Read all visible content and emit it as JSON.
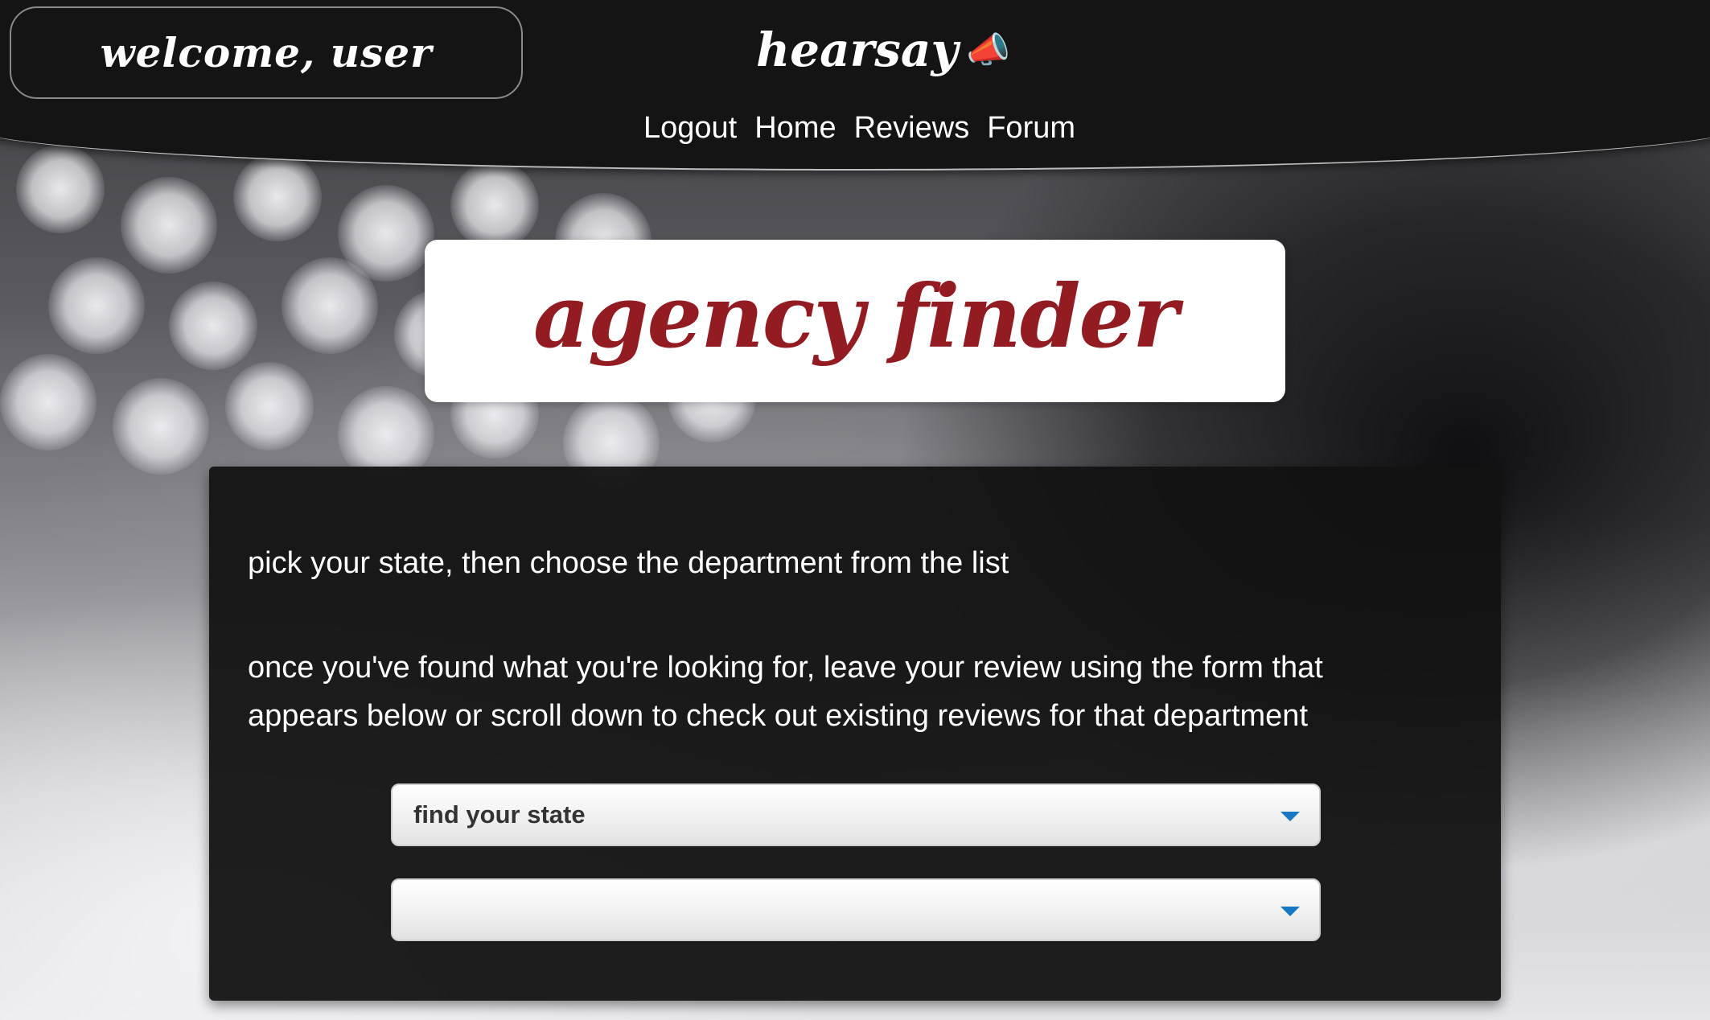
{
  "header": {
    "welcome_text": "welcome, user",
    "brand_name": "hearsay",
    "brand_icon": "megaphone-icon",
    "nav": [
      {
        "label": "Logout"
      },
      {
        "label": "Home"
      },
      {
        "label": "Reviews"
      },
      {
        "label": "Forum"
      }
    ]
  },
  "title_card": {
    "title": "agency finder"
  },
  "panel": {
    "intro_line_1": "pick your state, then choose the department from the list",
    "intro_line_2": "once you've found what you're looking for, leave your review using the form that appears below or scroll down to check out existing reviews for that department",
    "state_select": {
      "value": "find your state"
    },
    "department_select": {
      "value": ""
    }
  },
  "colors": {
    "header_bg": "#141414",
    "title_text": "#931b22",
    "panel_bg": "#121212",
    "select_caret": "#1779c4"
  }
}
